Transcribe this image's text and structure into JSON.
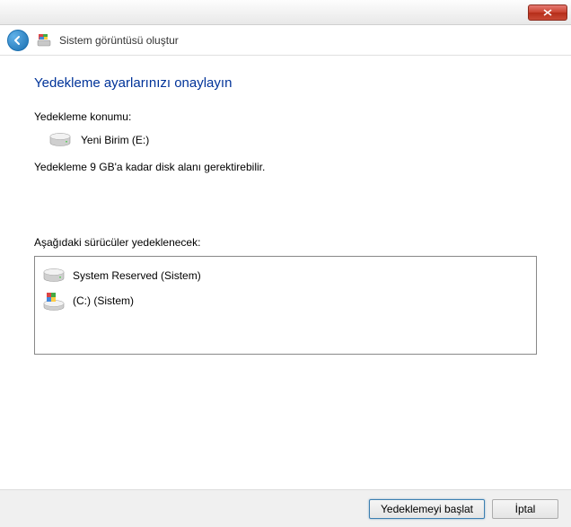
{
  "window": {
    "title": "Sistem görüntüsü oluştur"
  },
  "main": {
    "heading": "Yedekleme ayarlarınızı onaylayın",
    "location_label": "Yedekleme konumu:",
    "location_drive": "Yeni Birim (E:)",
    "size_note": "Yedekleme 9 GB'a kadar disk alanı gerektirebilir.",
    "drives_label": "Aşağıdaki sürücüler yedeklenecek:",
    "drives": [
      {
        "label": "System Reserved (Sistem)"
      },
      {
        "label": "(C:) (Sistem)"
      }
    ]
  },
  "footer": {
    "start_label": "Yedeklemeyi başlat",
    "cancel_label": "İptal"
  }
}
